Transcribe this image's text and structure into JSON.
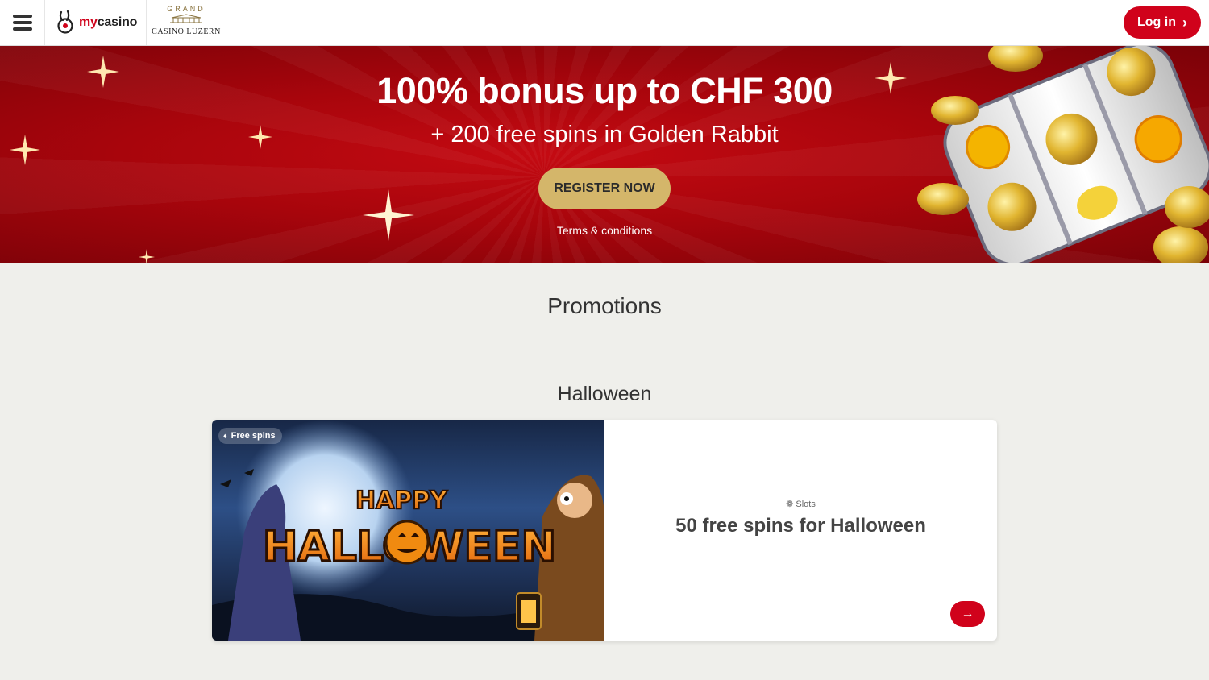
{
  "header": {
    "brand_prefix": "my",
    "brand_suffix": "casino",
    "partner_crown": "GRAND",
    "partner_name": "CASINO LUZERN",
    "login_label": "Log in"
  },
  "hero": {
    "title": "100% bonus up to CHF 300",
    "subtitle": "+ 200 free spins in Golden Rabbit",
    "cta_label": "REGISTER NOW",
    "terms_label": "Terms & conditions"
  },
  "promotions": {
    "heading": "Promotions",
    "sections": [
      {
        "title": "Halloween",
        "cards": [
          {
            "badge": "Free spins",
            "category": "Slots",
            "title": "50 free spins for Halloween",
            "image_text_top": "HAPPY",
            "image_text_main": "HALLOWEEN"
          }
        ]
      }
    ]
  },
  "colors": {
    "brand_red": "#d0021b",
    "gold": "#d4b66a",
    "page_bg": "#efefeb"
  }
}
